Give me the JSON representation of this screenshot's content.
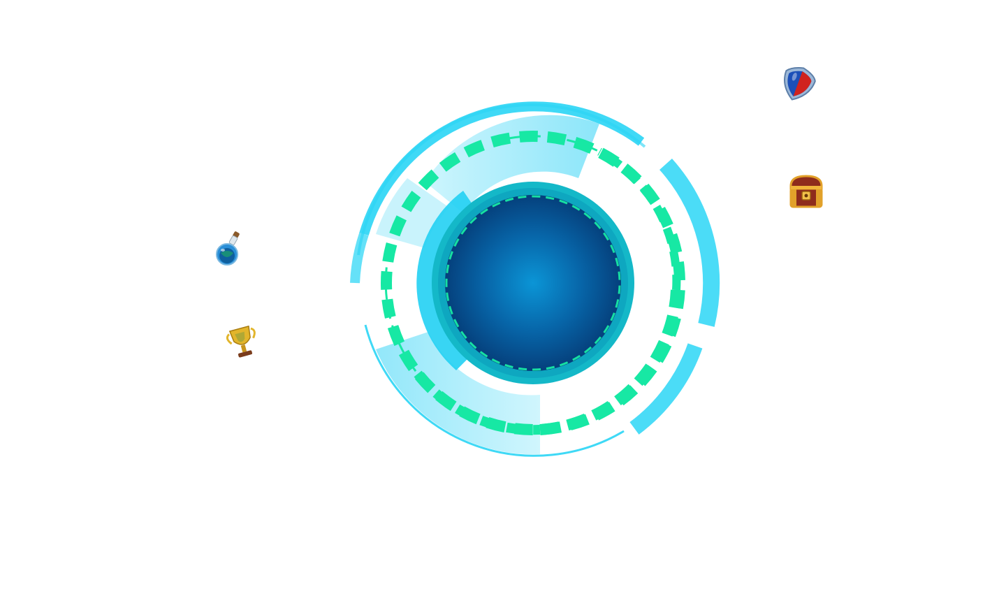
{
  "scene": {
    "name": "portal-hub",
    "background": "#ffffff"
  },
  "palette": {
    "ring_cyan": "#29d3f5",
    "ring_light": "#a9eefb",
    "dash_green": "#17e8a4",
    "teal_ring": "#14b8c8",
    "core_center": "#0a8fd0",
    "core_edge": "#06427e"
  },
  "portal": {
    "icon": "portal-orb-icon"
  },
  "items": [
    {
      "id": "potion",
      "icon": "potion-bottle-icon"
    },
    {
      "id": "trophy",
      "icon": "trophy-icon"
    },
    {
      "id": "shield",
      "icon": "shield-icon"
    },
    {
      "id": "chest",
      "icon": "treasure-chest-icon"
    }
  ]
}
